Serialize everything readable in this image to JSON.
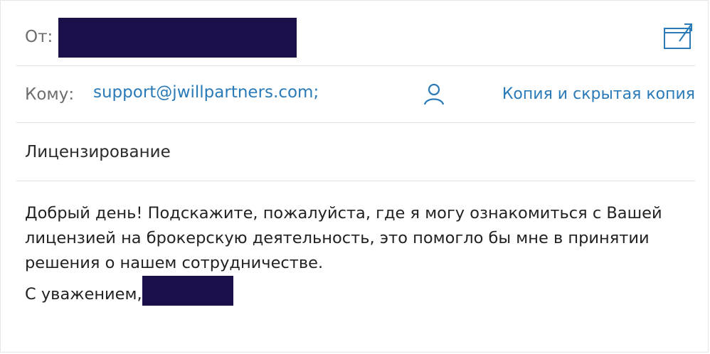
{
  "header": {
    "from_label": "От:",
    "to_label": "Кому:",
    "recipient": "support@jwillpartners.com;",
    "cc_bcc_label": "Копия и скрытая копия"
  },
  "subject": "Лицензирование",
  "message": {
    "lines": [
      "Добрый день! Подскажите, пожалуйста, где я могу ознакомиться с Вашей",
      "лицензией на брокерскую деятельность, это помогло бы мне в принятии",
      "решения о нашем сотрудничестве."
    ],
    "signoff": "С уважением,"
  },
  "icons": {
    "expand": "expand-window-icon",
    "people": "person-icon"
  },
  "colors": {
    "accent": "#2a7ab8",
    "redaction": "#1b0f4a",
    "divider": "#e1e1e1"
  }
}
